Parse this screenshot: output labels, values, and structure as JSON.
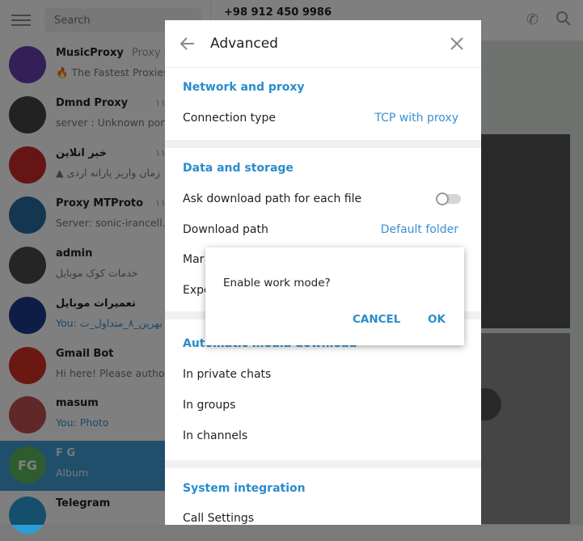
{
  "sidebar": {
    "search_placeholder": "Search",
    "chats": [
      {
        "name": "MusicProxy",
        "extra": "Proxy s",
        "time": "",
        "message": "🔥 The Fastest Proxies",
        "avatar_text": "",
        "avatar_color": "#6a3fb0"
      },
      {
        "name": "Dmnd Proxy",
        "extra": "",
        "time": "۱۱",
        "message": "server : Unknown port",
        "avatar_text": "",
        "avatar_color": "#444444"
      },
      {
        "name": "خبر انلاین",
        "extra": "",
        "time": "۱۱",
        "message": "▲ زمان واریز یارانه اردی",
        "avatar_text": "",
        "avatar_color": "#cc2a2a"
      },
      {
        "name": "Proxy MTProto",
        "extra": "",
        "time": "۱۱",
        "message": "Server: sonic-irancell.sit",
        "avatar_text": "",
        "avatar_color": "#2a6da0"
      },
      {
        "name": "admin",
        "extra": "",
        "time": "",
        "message": "خدمات کوک موبایل",
        "avatar_text": "",
        "avatar_color": "#4a4a4a"
      },
      {
        "name": "تعمیرات موبایل",
        "extra": "",
        "time": "",
        "message": "You: بهرین_۸_متداول_ت",
        "avatar_text": "",
        "avatar_color": "#1a3a8a"
      },
      {
        "name": "Gmail Bot",
        "extra": "",
        "time": "",
        "message": "Hi here! Please authori",
        "avatar_text": "",
        "avatar_color": "#d93025"
      },
      {
        "name": "masum",
        "extra": "",
        "time": "",
        "message": "You: Photo",
        "avatar_text": "",
        "avatar_color": "#c05050"
      },
      {
        "name": "F G",
        "extra": "",
        "time": "",
        "message": "Album",
        "avatar_text": "FG",
        "avatar_color": "#5cb85c"
      },
      {
        "name": "Telegram",
        "extra": "",
        "time": "",
        "message": "",
        "avatar_text": "",
        "avatar_color": "#2a9ed8"
      }
    ]
  },
  "topbar": {
    "phone": "+98 912 450 9986"
  },
  "advanced": {
    "title": "Advanced",
    "network": {
      "section_title": "Network and proxy",
      "connection_type_label": "Connection type",
      "connection_type_value": "TCP with proxy"
    },
    "data": {
      "section_title": "Data and storage",
      "ask_download_label": "Ask download path for each file",
      "ask_download_on": false,
      "download_path_label": "Download path",
      "download_path_value": "Default folder",
      "manage_label": "Mar",
      "export_label": "Expo"
    },
    "auto": {
      "section_title": "Automatic media download",
      "private_chats": "In private chats",
      "groups": "In groups",
      "channels": "In channels"
    },
    "system": {
      "section_title": "System integration",
      "call_settings": "Call Settings"
    }
  },
  "confirm": {
    "message": "Enable work mode?",
    "cancel": "CANCEL",
    "ok": "OK"
  },
  "colors": {
    "accent": "#2a8ccc",
    "active_chat": "#419fd9"
  }
}
